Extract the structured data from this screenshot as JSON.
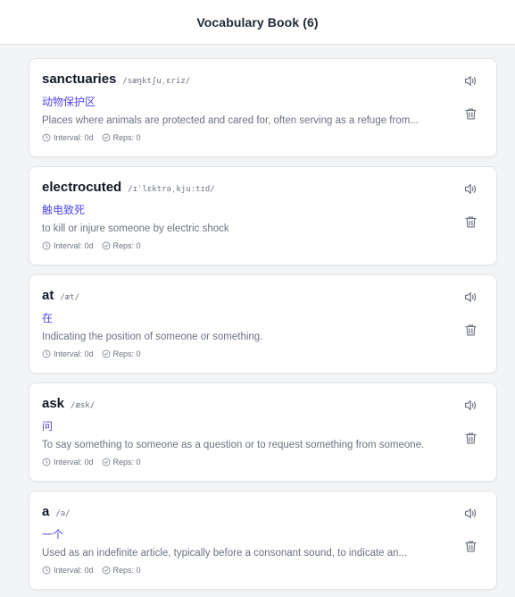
{
  "header": {
    "title": "Vocabulary Book (6)"
  },
  "icons": {
    "speak": "volume-icon",
    "delete": "trash-icon",
    "interval": "clock-icon",
    "reps": "check-circle-icon"
  },
  "colors": {
    "translation": "#4f46e5",
    "muted": "#6b7280",
    "word": "#111827"
  },
  "words": [
    {
      "word": "sanctuaries",
      "phonetic": "/sæŋktʃuˌɛriz/",
      "translation": "动物保护区",
      "definition": "Places where animals are protected and cared for, often serving as a refuge from...",
      "interval": "Interval: 0d",
      "reps": "Reps: 0"
    },
    {
      "word": "electrocuted",
      "phonetic": "/ɪˈlɛktrəˌkjuːtɪd/",
      "translation": "触电致死",
      "definition": "to kill or injure someone by electric shock",
      "interval": "Interval: 0d",
      "reps": "Reps: 0"
    },
    {
      "word": "at",
      "phonetic": "/æt/",
      "translation": "在",
      "definition": "Indicating the position of someone or something.",
      "interval": "Interval: 0d",
      "reps": "Reps: 0"
    },
    {
      "word": "ask",
      "phonetic": "/æsk/",
      "translation": "问",
      "definition": "To say something to someone as a question or to request something from someone.",
      "interval": "Interval: 0d",
      "reps": "Reps: 0"
    },
    {
      "word": "a",
      "phonetic": "/ə/",
      "translation": "一个",
      "definition": "Used as an indefinite article, typically before a consonant sound, to indicate an...",
      "interval": "Interval: 0d",
      "reps": "Reps: 0"
    }
  ]
}
